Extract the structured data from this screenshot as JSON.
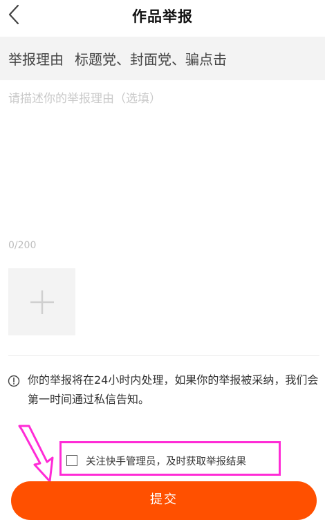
{
  "header": {
    "title": "作品举报",
    "back_icon": "chevron-left-icon"
  },
  "reason": {
    "label": "举报理由",
    "value": "标题党、封面党、骗点击"
  },
  "description": {
    "placeholder": "请描述你的举报理由（选填）",
    "value": "",
    "counter": "0/200"
  },
  "attachment": {
    "icon": "plus-icon"
  },
  "notice": {
    "icon": "info-circle-icon",
    "text": "你的举报将在24小时内处理，如果你的举报被采纳，我们会第一时间通过私信告知。"
  },
  "follow": {
    "checked": false,
    "label": "关注快手管理员，及时获取举报结果"
  },
  "annotation": {
    "highlight_color": "#ff2bd6"
  },
  "submit": {
    "label": "提交",
    "color": "#ff5000"
  }
}
